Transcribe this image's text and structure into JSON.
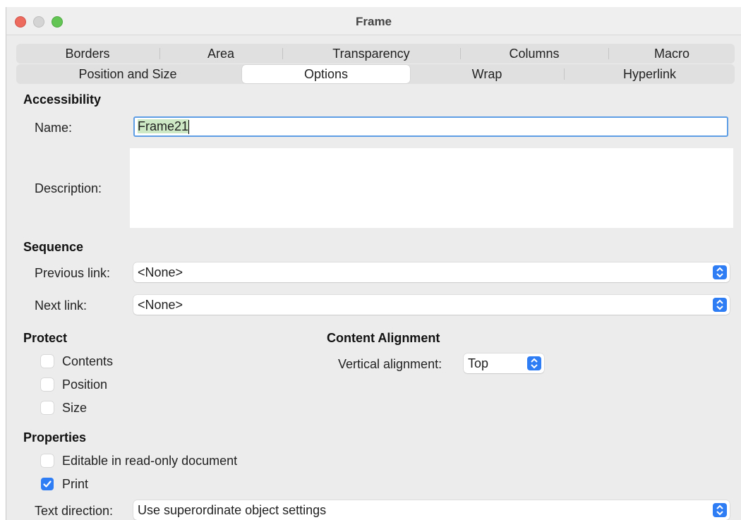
{
  "window": {
    "title": "Frame"
  },
  "tabs_row1": [
    "Borders",
    "Area",
    "Transparency",
    "Columns",
    "Macro"
  ],
  "tabs_row2": [
    "Position and Size",
    "Options",
    "Wrap",
    "Hyperlink"
  ],
  "active_tab": "Options",
  "accessibility": {
    "heading": "Accessibility",
    "name_label": "Name:",
    "name_value": "Frame21",
    "description_label": "Description:",
    "description_value": ""
  },
  "sequence": {
    "heading": "Sequence",
    "previous_label": "Previous link:",
    "previous_value": "<None>",
    "next_label": "Next link:",
    "next_value": "<None>"
  },
  "protect": {
    "heading": "Protect",
    "contents": {
      "label": "Contents",
      "checked": false
    },
    "position": {
      "label": "Position",
      "checked": false
    },
    "size": {
      "label": "Size",
      "checked": false
    }
  },
  "content_alignment": {
    "heading": "Content Alignment",
    "vertical_label": "Vertical alignment:",
    "vertical_value": "Top"
  },
  "properties": {
    "heading": "Properties",
    "editable": {
      "label": "Editable in read-only document",
      "checked": false
    },
    "print": {
      "label": "Print",
      "checked": true
    },
    "text_direction_label": "Text direction:",
    "text_direction_value": "Use superordinate object settings"
  },
  "colors": {
    "accent": "#2f7df5",
    "focus_ring": "#5e9ee4",
    "selection": "#cde8c4"
  }
}
